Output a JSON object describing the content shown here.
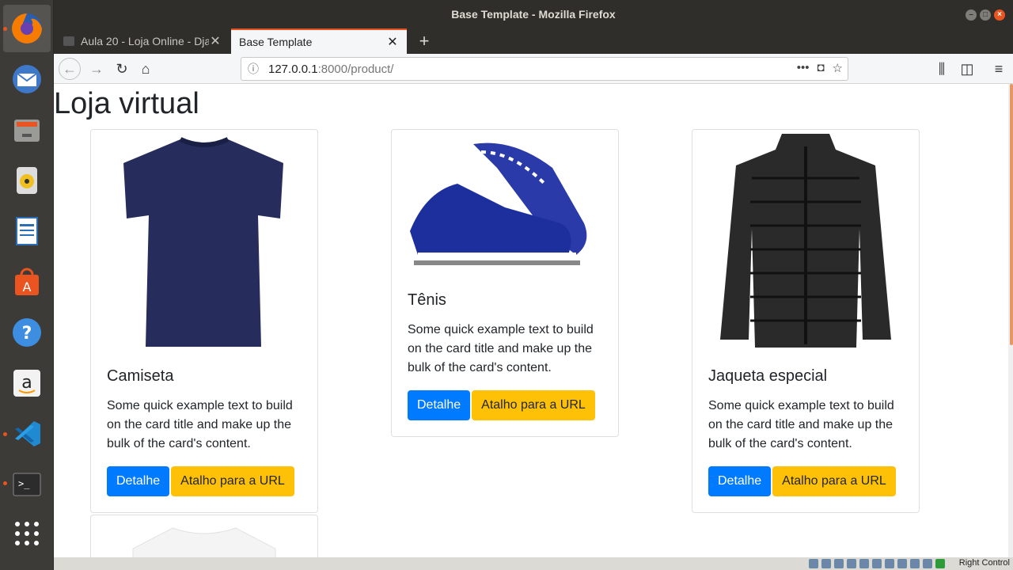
{
  "window": {
    "title": "Base Template - Mozilla Firefox"
  },
  "tabs": [
    {
      "label": "Aula 20 - Loja Online - Dja",
      "active": false
    },
    {
      "label": "Base Template",
      "active": true
    }
  ],
  "urlbar": {
    "host": "127.0.0.1",
    "path": ":8000/product/"
  },
  "page": {
    "title": "Loja virtual"
  },
  "products": [
    {
      "title": "Camiseta",
      "text": "Some quick example text to build on the card title and make up the bulk of the card's content.",
      "detail_label": "Detalhe",
      "shortcut_label": "Atalho para a URL",
      "icon": "tshirt-image"
    },
    {
      "title": "Tênis",
      "text": "Some quick example text to build on the card title and make up the bulk of the card's content.",
      "detail_label": "Detalhe",
      "shortcut_label": "Atalho para a URL",
      "icon": "sneaker-image"
    },
    {
      "title": "Jaqueta especial",
      "text": "Some quick example text to build on the card title and make up the bulk of the card's content.",
      "detail_label": "Detalhe",
      "shortcut_label": "Atalho para a URL",
      "icon": "jacket-image"
    }
  ],
  "statusbar": {
    "right_control": "Right Control"
  },
  "colors": {
    "primary": "#007bff",
    "warning": "#ffc107",
    "ubuntu_orange": "#e95420"
  }
}
